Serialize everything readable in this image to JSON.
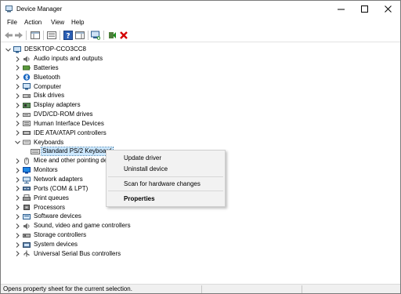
{
  "window": {
    "title": "Device Manager"
  },
  "menu": [
    "File",
    "Action",
    "View",
    "Help"
  ],
  "tree": {
    "root": "DESKTOP-CCO3CC8",
    "categories": [
      {
        "label": "Audio inputs and outputs",
        "icon": "speaker-icon"
      },
      {
        "label": "Batteries",
        "icon": "battery-icon"
      },
      {
        "label": "Bluetooth",
        "icon": "bluetooth-icon"
      },
      {
        "label": "Computer",
        "icon": "computer-icon"
      },
      {
        "label": "Disk drives",
        "icon": "disk-drive-icon"
      },
      {
        "label": "Display adapters",
        "icon": "display-adapter-icon"
      },
      {
        "label": "DVD/CD-ROM drives",
        "icon": "dvd-drive-icon"
      },
      {
        "label": "Human Interface Devices",
        "icon": "hid-icon"
      },
      {
        "label": "IDE ATA/ATAPI controllers",
        "icon": "ide-controller-icon"
      },
      {
        "label": "Keyboards",
        "icon": "keyboard-icon"
      },
      {
        "label": "Mice and other pointing de",
        "icon": "mouse-icon"
      },
      {
        "label": "Monitors",
        "icon": "monitor-icon"
      },
      {
        "label": "Network adapters",
        "icon": "network-adapter-icon"
      },
      {
        "label": "Ports (COM & LPT)",
        "icon": "port-icon"
      },
      {
        "label": "Print queues",
        "icon": "printer-icon"
      },
      {
        "label": "Processors",
        "icon": "processor-icon"
      },
      {
        "label": "Software devices",
        "icon": "software-device-icon"
      },
      {
        "label": "Sound, video and game controllers",
        "icon": "sound-controller-icon"
      },
      {
        "label": "Storage controllers",
        "icon": "storage-controller-icon"
      },
      {
        "label": "System devices",
        "icon": "system-device-icon"
      },
      {
        "label": "Universal Serial Bus controllers",
        "icon": "usb-icon"
      }
    ],
    "keyboard_child": "Standard PS/2 Keyboard"
  },
  "context_menu": {
    "update": "Update driver",
    "uninstall": "Uninstall device",
    "scan": "Scan for hardware changes",
    "properties": "Properties"
  },
  "status": {
    "text": "Opens property sheet for the current selection."
  },
  "colors": {
    "selection": "#cce8ff",
    "accent": "#0078d7",
    "delete_red": "#d40000",
    "enable_green": "#1b8a1b"
  }
}
